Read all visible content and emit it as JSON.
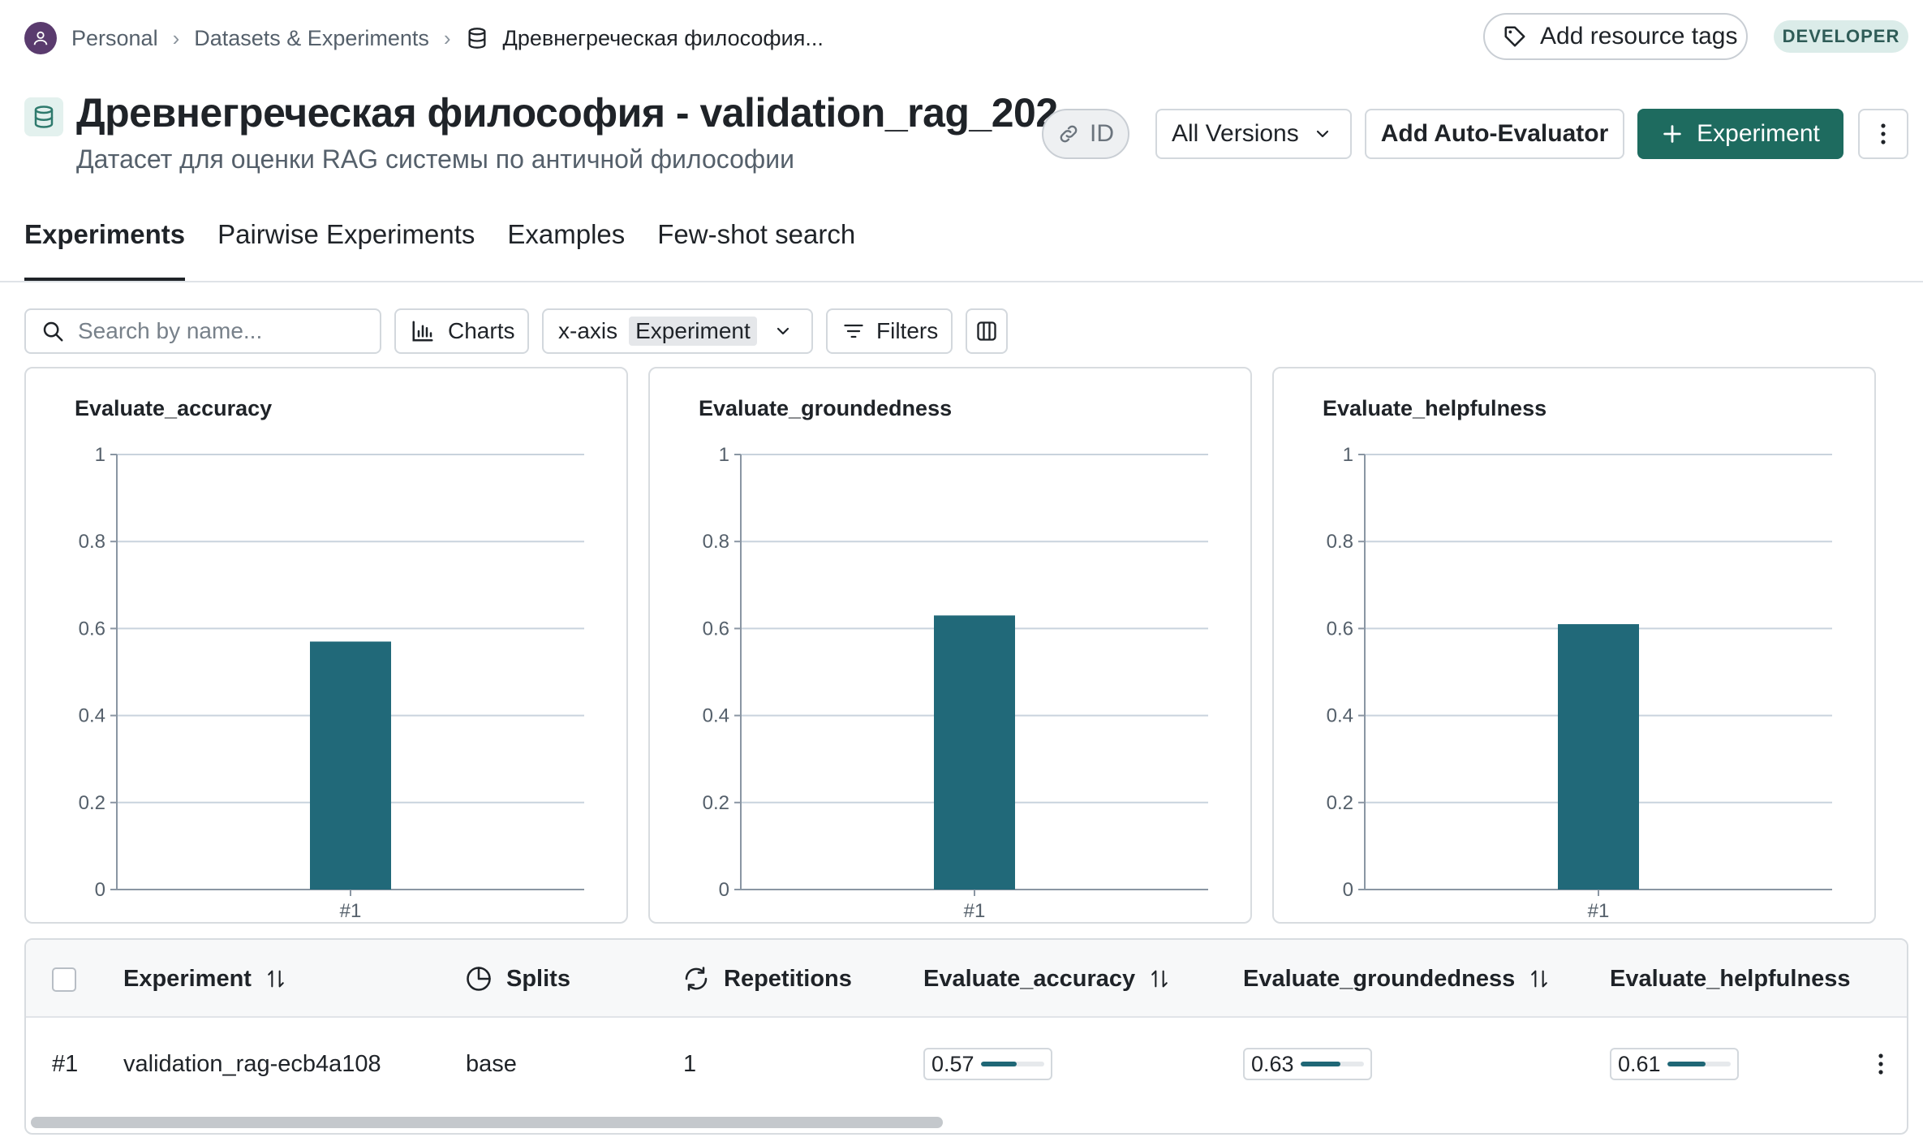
{
  "breadcrumb": {
    "items": [
      "Personal",
      "Datasets & Experiments",
      "Древнегреческая философия..."
    ]
  },
  "header": {
    "add_tags_label": "Add resource tags",
    "badge": "DEVELOPER",
    "title": "Древнегреческая философия - validation_rag_202...",
    "subtitle": "Датасет для оценки RAG системы по античной философии",
    "id_label": "ID",
    "versions_label": "All Versions",
    "auto_eval_label": "Add Auto-Evaluator",
    "experiment_label": "Experiment"
  },
  "tabs": [
    {
      "label": "Experiments",
      "active": true
    },
    {
      "label": "Pairwise Experiments",
      "active": false
    },
    {
      "label": "Examples",
      "active": false
    },
    {
      "label": "Few-shot search",
      "active": false
    }
  ],
  "toolbar": {
    "search_placeholder": "Search by name...",
    "charts_label": "Charts",
    "xaxis_label": "x-axis",
    "xaxis_value": "Experiment",
    "filters_label": "Filters"
  },
  "colors": {
    "bar": "#216979",
    "primary": "#1e6b5f",
    "grid": "#c9d3dd"
  },
  "chart_data": [
    {
      "type": "bar",
      "title": "Evaluate_accuracy",
      "categories": [
        "#1"
      ],
      "values": [
        0.57
      ],
      "ylim": [
        0,
        1
      ],
      "yticks": [
        "0",
        "0.2",
        "0.4",
        "0.6",
        "0.8",
        "1"
      ],
      "grid": true
    },
    {
      "type": "bar",
      "title": "Evaluate_groundedness",
      "categories": [
        "#1"
      ],
      "values": [
        0.63
      ],
      "ylim": [
        0,
        1
      ],
      "yticks": [
        "0",
        "0.2",
        "0.4",
        "0.6",
        "0.8",
        "1"
      ],
      "grid": true
    },
    {
      "type": "bar",
      "title": "Evaluate_helpfulness",
      "categories": [
        "#1"
      ],
      "values": [
        0.61
      ],
      "ylim": [
        0,
        1
      ],
      "yticks": [
        "0",
        "0.2",
        "0.4",
        "0.6",
        "0.8",
        "1"
      ],
      "grid": true
    }
  ],
  "table": {
    "headers": {
      "experiment": "Experiment",
      "splits": "Splits",
      "repetitions": "Repetitions",
      "accuracy": "Evaluate_accuracy",
      "groundedness": "Evaluate_groundedness",
      "helpfulness": "Evaluate_helpfulness"
    },
    "rows": [
      {
        "index": "#1",
        "name": "validation_rag-ecb4a108",
        "splits": "base",
        "repetitions": "1",
        "accuracy": "0.57",
        "groundedness": "0.63",
        "helpfulness": "0.61",
        "accuracy_value": 0.57,
        "groundedness_value": 0.63,
        "helpfulness_value": 0.61
      }
    ]
  }
}
